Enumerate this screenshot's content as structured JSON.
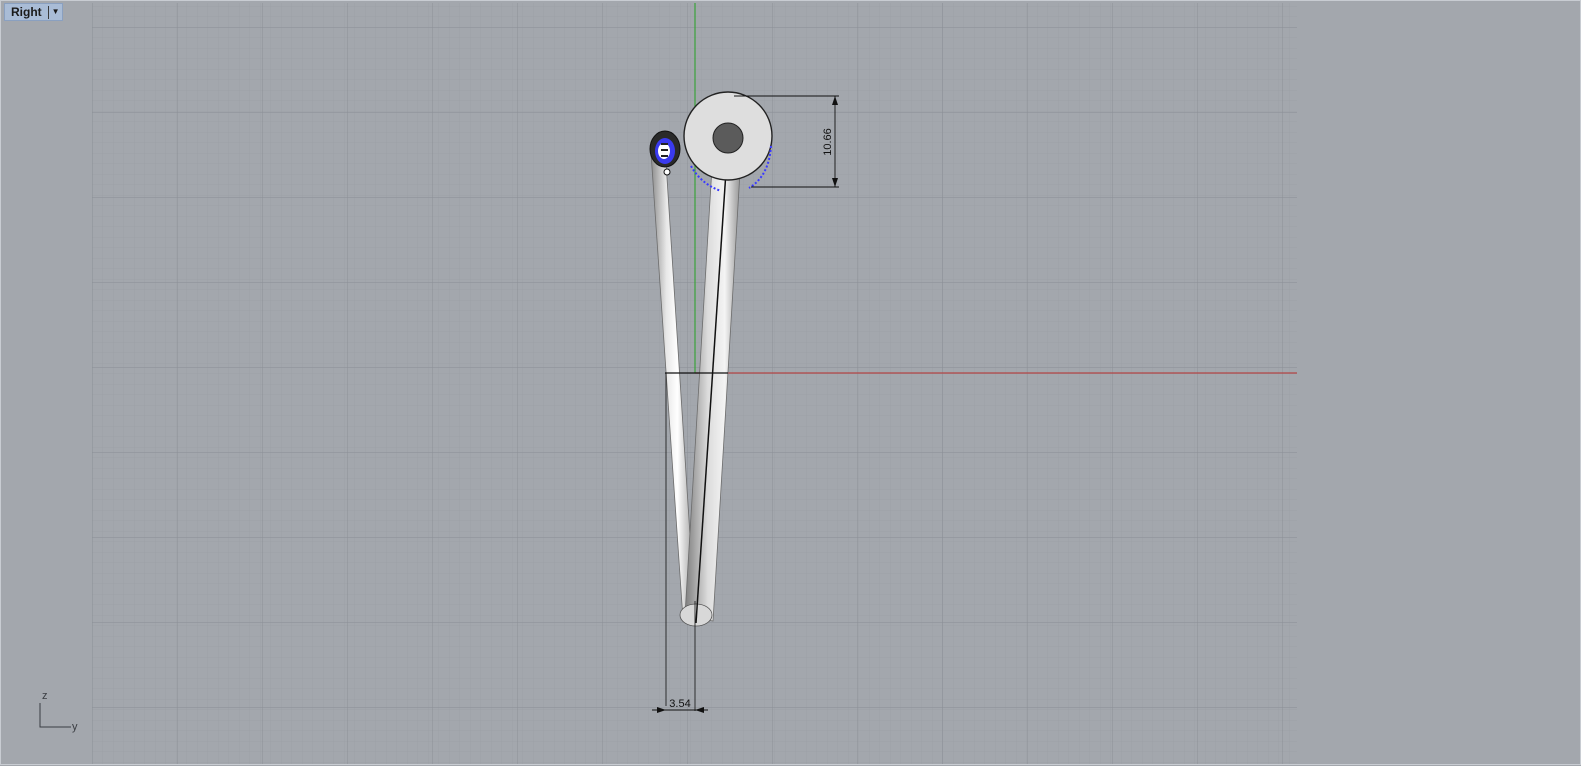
{
  "viewport": {
    "name": "Right",
    "menu_icon": "chevron-down-icon"
  },
  "axis_indicator": {
    "vertical_label": "z",
    "horizontal_label": "y"
  },
  "dimensions": {
    "vertical_value": "10.66",
    "horizontal_value": "3.54"
  },
  "colors": {
    "background": "#a3a7ad",
    "grid_minor": "#9a9ea5",
    "grid_major": "#8a8e95",
    "x_axis": "#b34545",
    "y_axis": "#3aa33a",
    "tab_bg": "#a9bcd6"
  }
}
